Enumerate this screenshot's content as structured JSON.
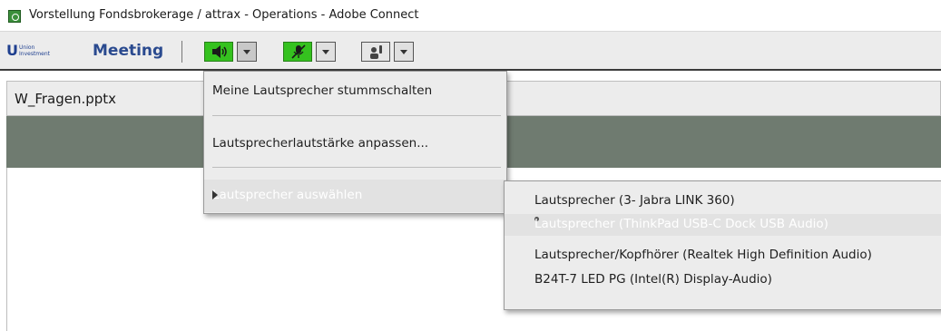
{
  "window": {
    "title": "Vorstellung Fondsbrokerage / attrax - Operations - Adobe Connect"
  },
  "toolbar": {
    "brand": "Union Investment",
    "meeting_label": "Meeting",
    "speaker_icon": "speaker-icon",
    "mic_icon": "microphone-muted-icon",
    "hand_icon": "raise-hand-icon"
  },
  "pod": {
    "title": "W_Fragen.pptx"
  },
  "speaker_menu": {
    "items": [
      {
        "label": "Meine Lautsprecher stummschalten"
      },
      {
        "label": "Lautsprecherlautstärke anpassen..."
      },
      {
        "label": "Lautsprecher auswählen"
      }
    ]
  },
  "speaker_submenu": {
    "items": [
      {
        "label": "Lautsprecher (3- Jabra LINK 360)"
      },
      {
        "label": "Lautsprecher (ThinkPad USB-C Dock USB Audio)",
        "selected": true
      },
      {
        "label": "Lautsprecher/Kopfhörer (Realtek High Definition Audio)"
      },
      {
        "label": "B24T-7 LED PG (Intel(R) Display-Audio)"
      }
    ]
  },
  "colors": {
    "accent_green": "#35c21f",
    "pod_bar": "#6f7b70",
    "brand_blue": "#1e3f8f"
  }
}
